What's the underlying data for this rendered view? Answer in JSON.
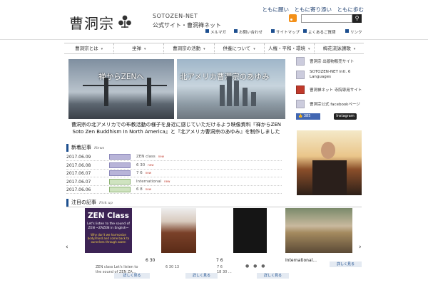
{
  "header": {
    "logo": "曹洞宗",
    "site_en": "SOTOZEN-NET",
    "site_jp": "公式サイト・曹洞禅ネット",
    "slogan": "ともに願い　ともに寄り添い　ともに歩む",
    "search_placeholder": "",
    "util_links": [
      "メルマガ",
      "お問い合わせ",
      "サイトマップ",
      "よくあるご質問",
      "リンク"
    ]
  },
  "nav": {
    "items": [
      "曹洞宗とは",
      "坐禅",
      "曹洞宗の活動",
      "供養について",
      "人権・平和・環境",
      "梅花流詠讃歌"
    ]
  },
  "banners": [
    {
      "title": "禅からZENへ"
    },
    {
      "title": "北アメリカ曹洞宗のあゆみ"
    }
  ],
  "caption": {
    "line1": "曹洞宗の北アメリカでの布教活動の様子を身近に感じていただけるよう映像資料『禅からZEN",
    "line2": "Soto Zen Buddhism In North America』と『北アメリカ曹洞宗のあゆみ』を制作しました"
  },
  "sidebar": {
    "items": [
      "曹洞宗 出版物販売サイト",
      "SOTOZEN-NET Intl. 6 Languages",
      "曹洞禅ネット 寺院専用サイト",
      "曹洞宗公式 facebookページ"
    ],
    "fb_count": "385",
    "instagram": "Instagram"
  },
  "news": {
    "heading": "新着記事",
    "heading_en": "News",
    "tabs": [
      "",
      "",
      "",
      "",
      "",
      ""
    ],
    "rows": [
      {
        "date": "2017.06.09",
        "text": "ZEN class",
        "badge": "new"
      },
      {
        "date": "2017.06.08",
        "text": "6 30",
        "badge": "new"
      },
      {
        "date": "2017.06.07",
        "text": "7 6",
        "badge": "new"
      },
      {
        "date": "2017.06.07",
        "text": "International",
        "badge": "new"
      },
      {
        "date": "2017.06.06",
        "text": "6 8",
        "badge": "new"
      }
    ]
  },
  "pickup": {
    "heading": "注目の記事",
    "heading_en": "Pick up",
    "cards": [
      {
        "img_title": "ZEN Class",
        "img_sub": "Let's listen to the sound of ZEN ~ZAZEN in English~",
        "img_yellow": "Why don't we harmonize body/mind and come back to ourselves through zazen",
        "title": "",
        "desc1": "ZEN class  Let's listen to",
        "desc2": "the sound of ZEN ZA...",
        "button": "詳しく見る"
      },
      {
        "title": "6 30",
        "desc1": "6 30  13",
        "desc2": "",
        "button": "詳しく見る"
      },
      {
        "img_title": "",
        "title": "7 6",
        "desc1": "7 6",
        "desc2": "18 30 ...",
        "button": "詳しく見る"
      },
      {
        "title": "International...",
        "desc1": "",
        "desc2": "",
        "button": "詳しく見る"
      }
    ],
    "more_label": ""
  },
  "colors": {
    "accent": "#1d4f8f",
    "category_badge": "#b8b4d8",
    "new_badge": "#c0392b",
    "facebook": "#4267b2"
  }
}
